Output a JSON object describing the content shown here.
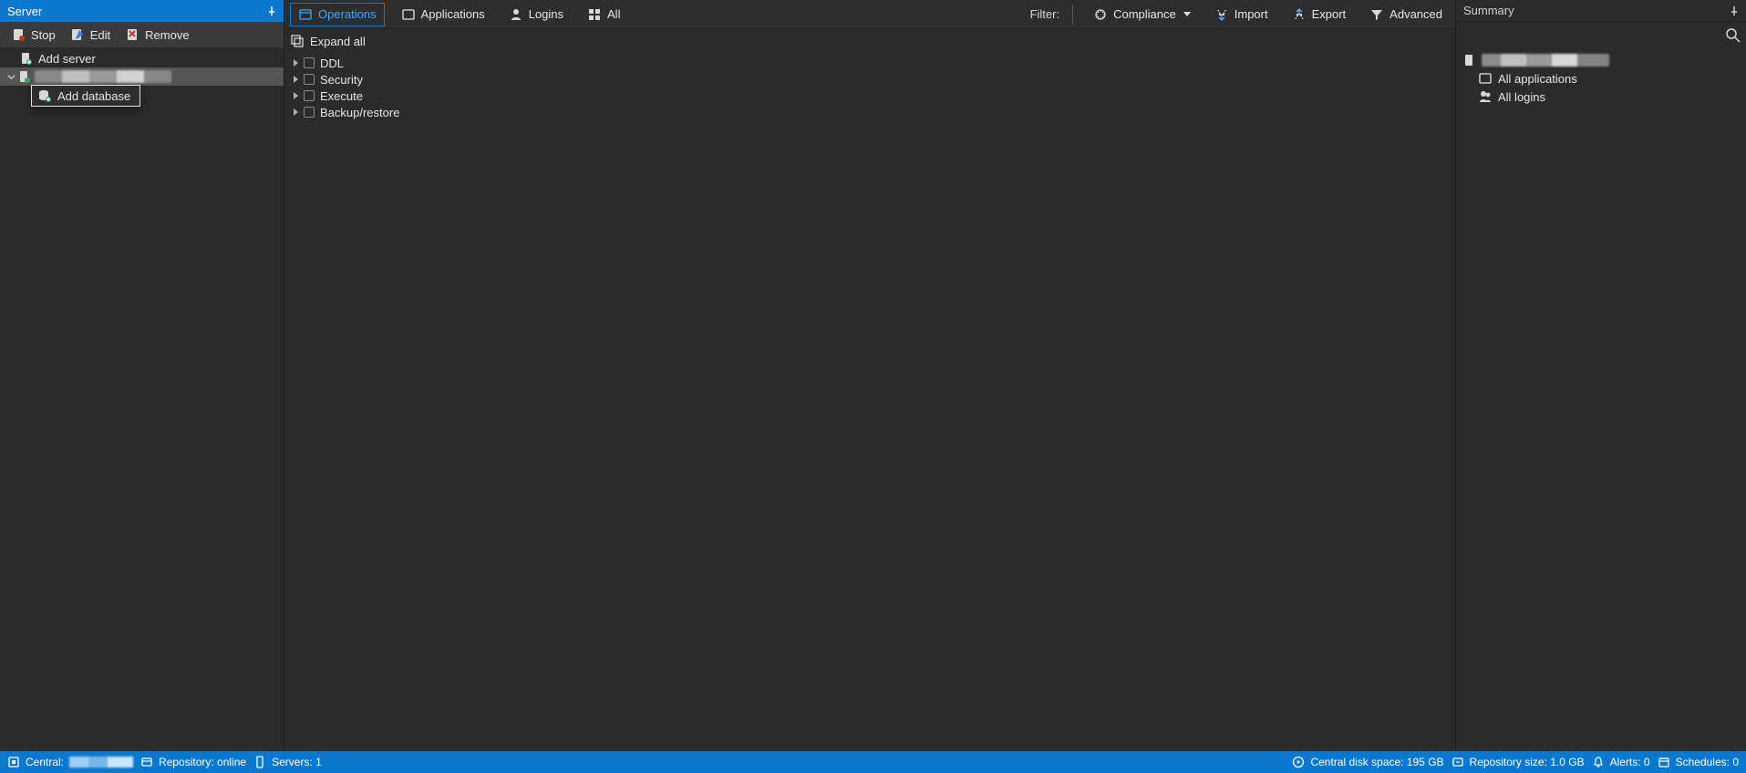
{
  "left": {
    "title": "Server",
    "toolbar": {
      "stop": "Stop",
      "edit": "Edit",
      "remove": "Remove"
    },
    "tree": {
      "add_server": "Add server"
    },
    "context_menu": {
      "add_database": "Add database"
    }
  },
  "center": {
    "tabs": {
      "operations": "Operations",
      "applications": "Applications",
      "logins": "Logins",
      "all": "All"
    },
    "filter_label": "Filter:",
    "filter_buttons": {
      "compliance": "Compliance",
      "import": "Import",
      "export": "Export",
      "advanced": "Advanced"
    },
    "subbar": {
      "expand_all": "Expand all"
    },
    "operations": [
      {
        "label": "DDL"
      },
      {
        "label": "Security"
      },
      {
        "label": "Execute"
      },
      {
        "label": "Backup/restore"
      }
    ]
  },
  "right": {
    "title": "Summary",
    "items": {
      "all_applications": "All applications",
      "all_logins": "All logins"
    }
  },
  "statusbar": {
    "central": "Central:",
    "repository": "Repository: online",
    "servers": "Servers: 1",
    "disk": "Central disk space: 195 GB",
    "repo_size": "Repository size: 1.0 GB",
    "alerts": "Alerts: 0",
    "schedules": "Schedules: 0"
  }
}
